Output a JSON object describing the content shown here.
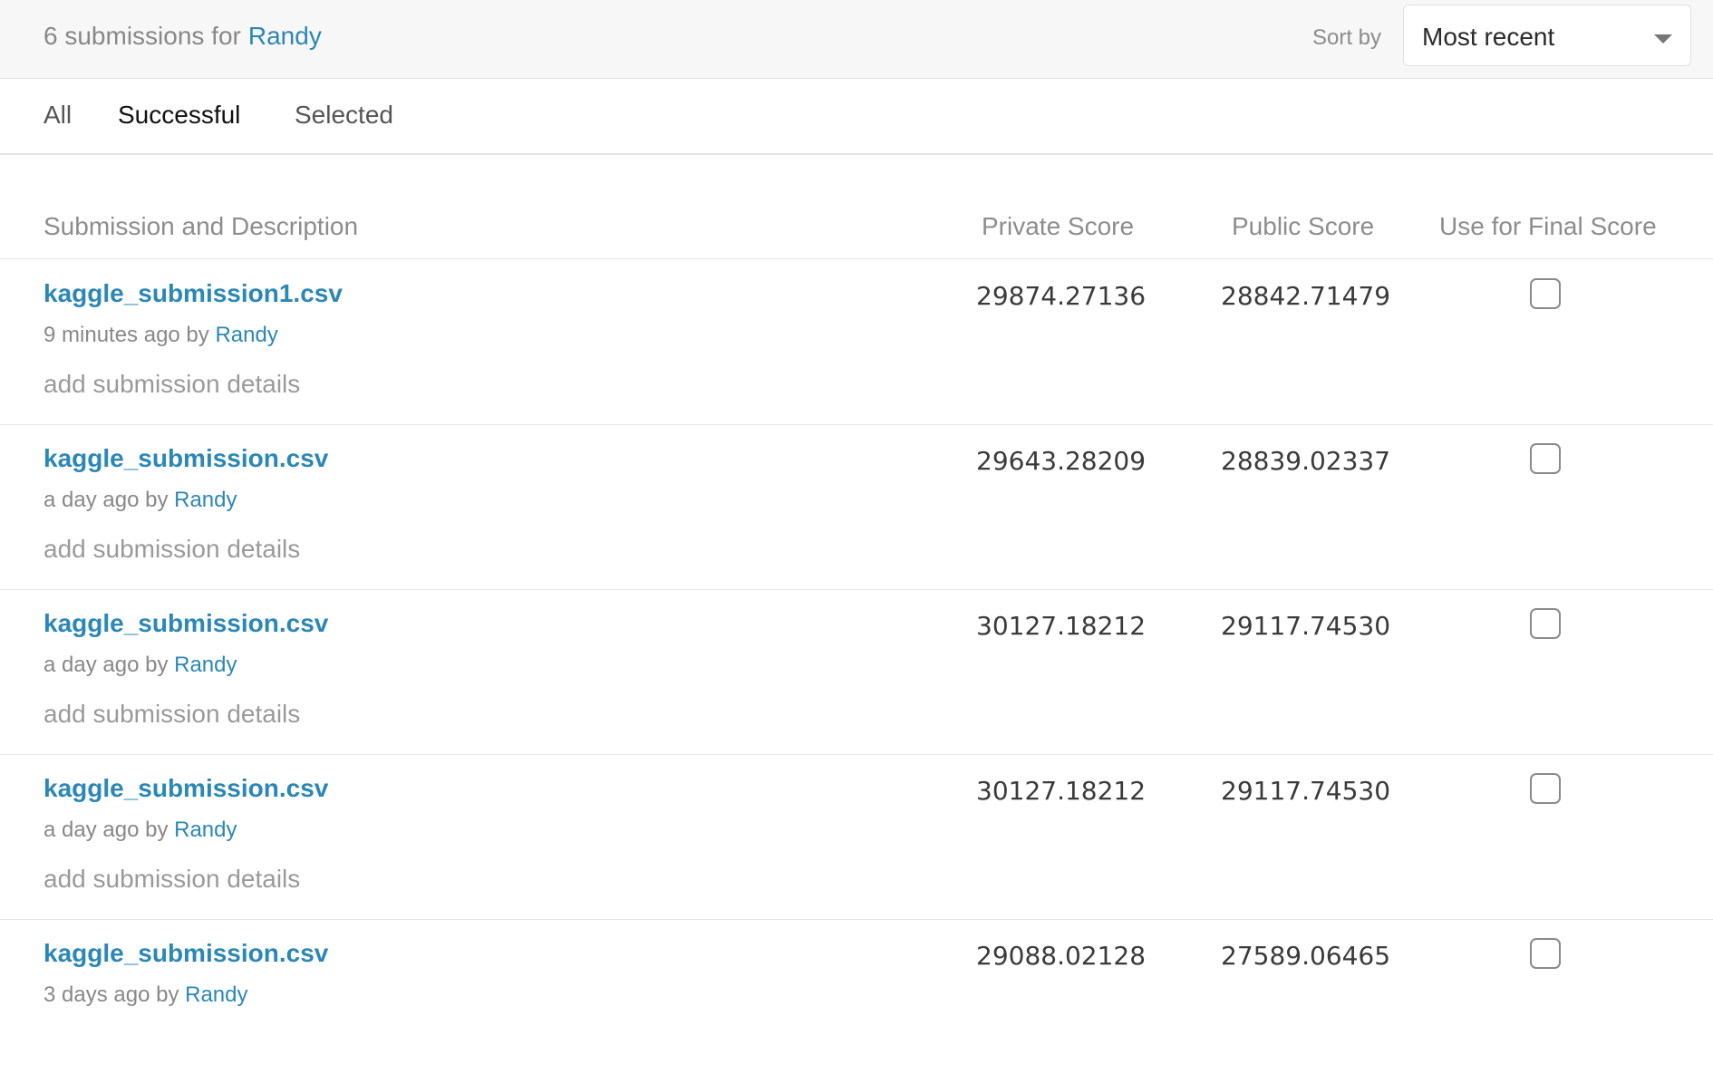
{
  "header": {
    "count_text": "6 submissions for",
    "owner": "Randy",
    "sort_label": "Sort by",
    "sort_value": "Most recent"
  },
  "tabs": [
    {
      "label": "All",
      "active": false
    },
    {
      "label": "Successful",
      "active": true
    },
    {
      "label": "Selected",
      "active": false
    }
  ],
  "table": {
    "columns": [
      "Submission and Description",
      "Private Score",
      "Public Score",
      "Use for Final Score"
    ],
    "rows": [
      {
        "file": "kaggle_submission1.csv",
        "time": "9 minutes ago by",
        "by": "Randy",
        "details": "add submission details",
        "private": "29874.27136",
        "public": "28842.71479",
        "selected": false
      },
      {
        "file": "kaggle_submission.csv",
        "time": "a day ago by",
        "by": "Randy",
        "details": "add submission details",
        "private": "29643.28209",
        "public": "28839.02337",
        "selected": false
      },
      {
        "file": "kaggle_submission.csv",
        "time": "a day ago by",
        "by": "Randy",
        "details": "add submission details",
        "private": "30127.18212",
        "public": "29117.74530",
        "selected": false
      },
      {
        "file": "kaggle_submission.csv",
        "time": "a day ago by",
        "by": "Randy",
        "details": "add submission details",
        "private": "30127.18212",
        "public": "29117.74530",
        "selected": false
      },
      {
        "file": "kaggle_submission.csv",
        "time": "3 days ago by",
        "by": "Randy",
        "details": "",
        "private": "29088.02128",
        "public": "27589.06465",
        "selected": false
      }
    ]
  }
}
